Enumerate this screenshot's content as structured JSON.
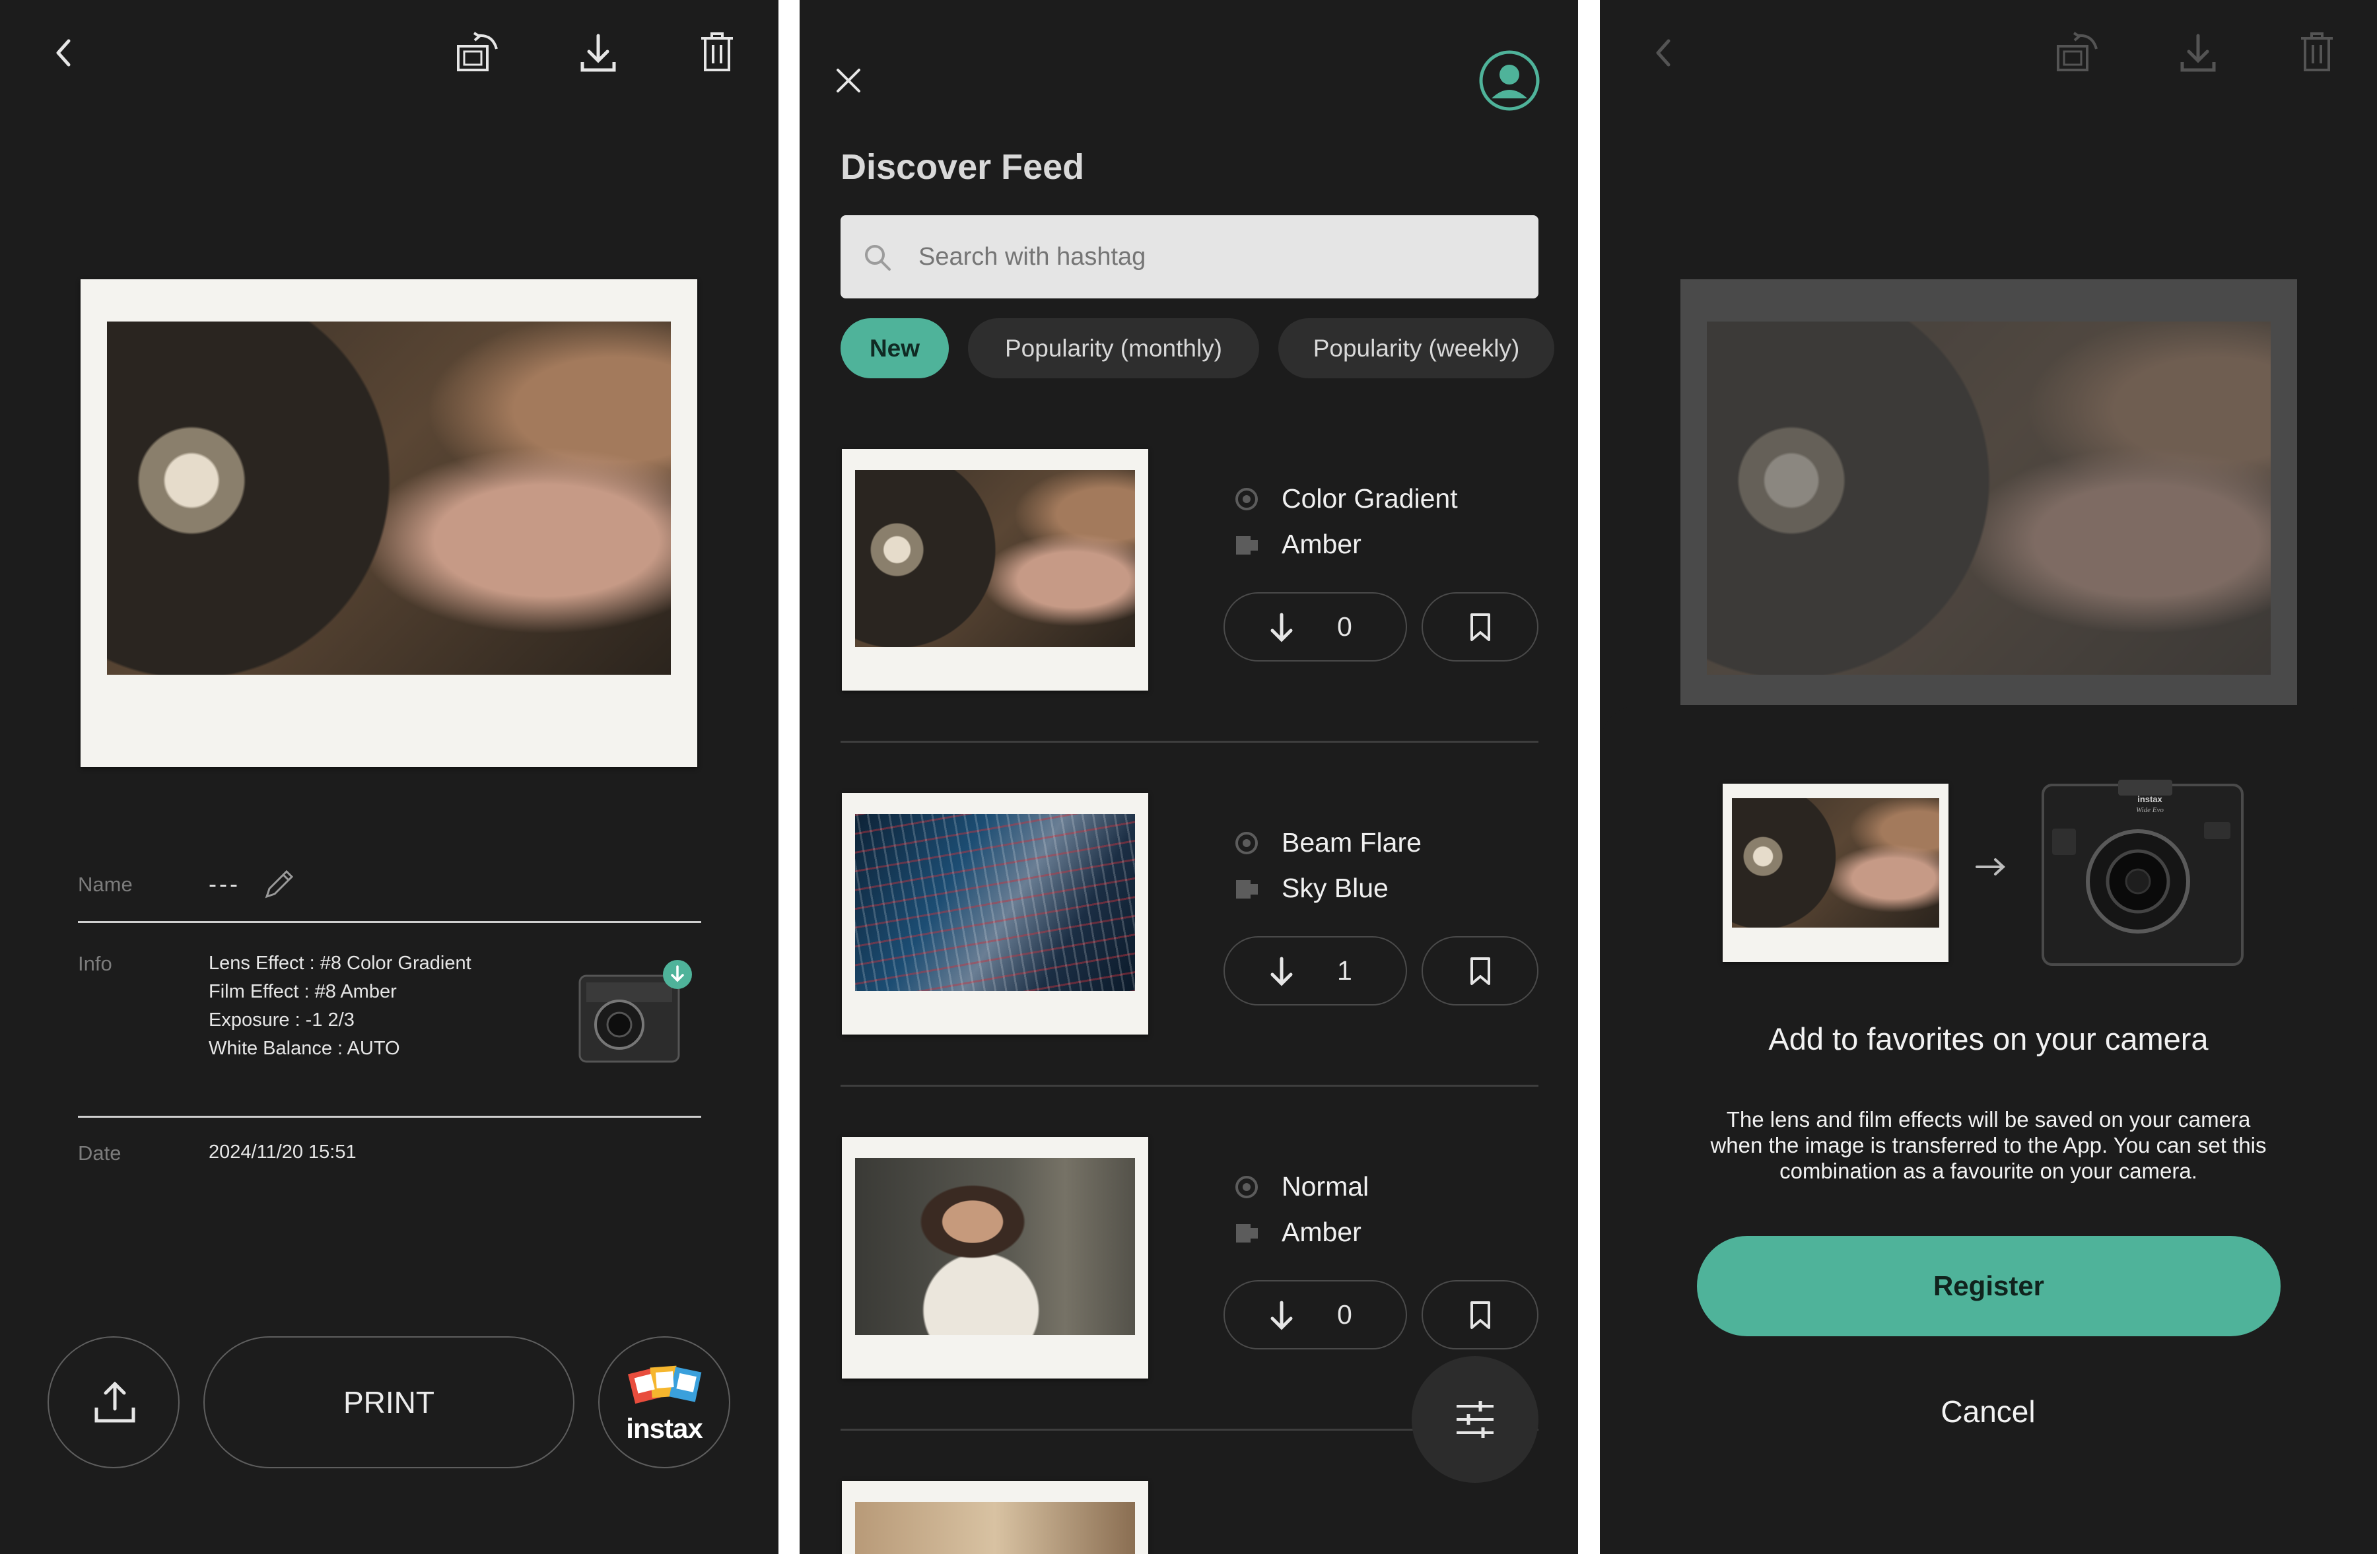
{
  "detail": {
    "preview_photo": "turntable-photo",
    "name_label": "Name",
    "name_value": "---",
    "info_label": "Info",
    "info_lines": [
      "Lens Effect : #8 Color Gradient",
      "Film Effect : #8 Amber",
      "Exposure : -1 2/3",
      "White Balance : AUTO"
    ],
    "date_label": "Date",
    "date_value": "2024/11/20 15:51",
    "print_label": "PRINT",
    "instax_label": "instax"
  },
  "feed": {
    "title": "Discover Feed",
    "search_placeholder": "Search with hashtag",
    "filters": [
      "New",
      "Popularity (monthly)",
      "Popularity (weekly)"
    ],
    "active_filter": "New",
    "items": [
      {
        "lens": "Color Gradient",
        "film": "Amber",
        "downloads": "0",
        "photo": "turntable-photo"
      },
      {
        "lens": "Beam Flare",
        "film": "Sky Blue",
        "downloads": "1",
        "photo": "building-photo"
      },
      {
        "lens": "Normal",
        "film": "Amber",
        "downloads": "0",
        "photo": "portrait-photo"
      }
    ],
    "accent_color": "#4fb39a"
  },
  "register_sheet": {
    "camera_brand": "instax",
    "camera_model_script": "Wide Evo",
    "title": "Add to favorites on your camera",
    "body_lines": [
      "The lens and film effects will be saved on your camera",
      "when the image is transferred to the App. You can set this",
      "combination as a favourite on your camera."
    ],
    "register_label": "Register",
    "cancel_label": "Cancel"
  },
  "colors": {
    "background": "#1c1c1c",
    "accent": "#4fb39a",
    "text": "#ececec",
    "muted": "#7c7c7c"
  }
}
